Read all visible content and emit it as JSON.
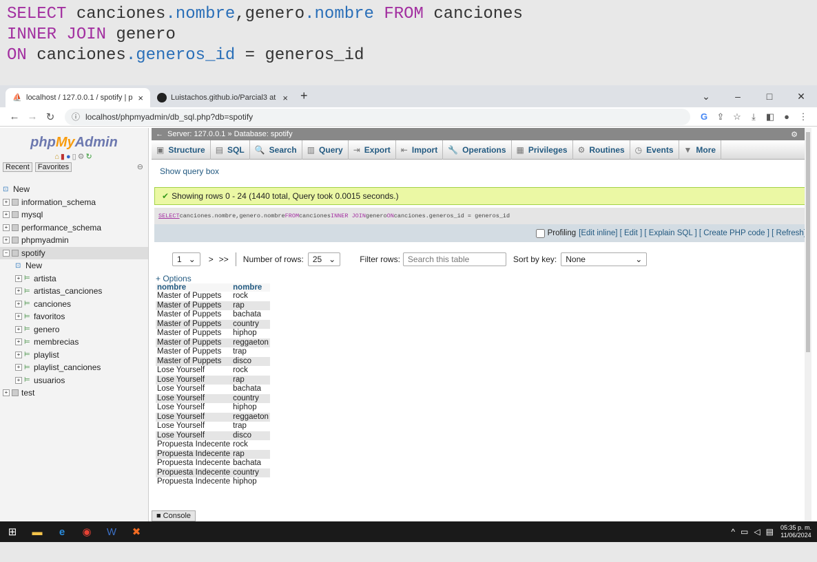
{
  "code_snippet": {
    "line1": {
      "kw1": "SELECT",
      "t1": " canciones",
      "d1": ".nombre",
      "t2": ",genero",
      "d2": ".nombre",
      "kw2": " FROM",
      "t3": " canciones"
    },
    "line2": {
      "kw": "INNER JOIN",
      "t": " genero"
    },
    "line3": {
      "kw": "ON",
      "t1": " canciones",
      "d": ".generos_id",
      "t2": " = generos_id"
    }
  },
  "browser": {
    "tabs": [
      {
        "title": "localhost / 127.0.0.1 / spotify | p",
        "close": "×"
      },
      {
        "title": "Luistachos.github.io/Parcial3 at",
        "close": "×"
      }
    ],
    "new_tab": "+",
    "url": "localhost/phpmyadmin/db_sql.php?db=spotify",
    "window_controls": [
      "⌄",
      "–",
      "□",
      "✕"
    ]
  },
  "sidebar": {
    "logo_php": "php",
    "logo_my": "My",
    "logo_admin": "Admin",
    "recent": "Recent",
    "favorites": "Favorites",
    "tree": [
      {
        "label": "New",
        "level": 0,
        "type": "new"
      },
      {
        "label": "information_schema",
        "level": 0,
        "type": "db"
      },
      {
        "label": "mysql",
        "level": 0,
        "type": "db"
      },
      {
        "label": "performance_schema",
        "level": 0,
        "type": "db"
      },
      {
        "label": "phpmyadmin",
        "level": 0,
        "type": "db"
      },
      {
        "label": "spotify",
        "level": 0,
        "type": "db",
        "selected": true
      },
      {
        "label": "New",
        "level": 1,
        "type": "new"
      },
      {
        "label": "artista",
        "level": 1,
        "type": "table"
      },
      {
        "label": "artistas_canciones",
        "level": 1,
        "type": "table"
      },
      {
        "label": "canciones",
        "level": 1,
        "type": "table"
      },
      {
        "label": "favoritos",
        "level": 1,
        "type": "table"
      },
      {
        "label": "genero",
        "level": 1,
        "type": "table"
      },
      {
        "label": "membrecias",
        "level": 1,
        "type": "table"
      },
      {
        "label": "playlist",
        "level": 1,
        "type": "table"
      },
      {
        "label": "playlist_canciones",
        "level": 1,
        "type": "table"
      },
      {
        "label": "usuarios",
        "level": 1,
        "type": "table"
      },
      {
        "label": "test",
        "level": 0,
        "type": "db"
      }
    ]
  },
  "main": {
    "breadcrumb": "Server: 127.0.0.1 » Database: spotify",
    "tabs": [
      "Structure",
      "SQL",
      "Search",
      "Query",
      "Export",
      "Import",
      "Operations",
      "Privileges",
      "Routines",
      "Events",
      "More"
    ],
    "show_query_box": "Show query box",
    "success_msg": "Showing rows 0 - 24 (1440 total, Query took 0.0015 seconds.)",
    "sql_text": {
      "k1": "SELECT",
      "a": " canciones.nombre,genero.nombre ",
      "k2": "FROM",
      "b": " canciones ",
      "k3": "INNER JOIN",
      "c": " genero ",
      "k4": "ON",
      "d": " canciones.generos_id = generos_id"
    },
    "profiling": "Profiling",
    "links": "[Edit inline] [ Edit ] [ Explain SQL ] [ Create PHP code ] [ Refresh]",
    "page_value": "1",
    "next": ">",
    "last": ">>",
    "rows_label": "Number of rows:",
    "rows_value": "25",
    "filter_label": "Filter rows:",
    "filter_placeholder": "Search this table",
    "sort_label": "Sort by key:",
    "sort_value": "None",
    "options": "+ Options",
    "columns": [
      "nombre",
      "nombre"
    ],
    "rows": [
      [
        "Master of Puppets",
        "rock"
      ],
      [
        "Master of Puppets",
        "rap"
      ],
      [
        "Master of Puppets",
        "bachata"
      ],
      [
        "Master of Puppets",
        "country"
      ],
      [
        "Master of Puppets",
        "hiphop"
      ],
      [
        "Master of Puppets",
        "reggaeton"
      ],
      [
        "Master of Puppets",
        "trap"
      ],
      [
        "Master of Puppets",
        "disco"
      ],
      [
        "Lose Yourself",
        "rock"
      ],
      [
        "Lose Yourself",
        "rap"
      ],
      [
        "Lose Yourself",
        "bachata"
      ],
      [
        "Lose Yourself",
        "country"
      ],
      [
        "Lose Yourself",
        "hiphop"
      ],
      [
        "Lose Yourself",
        "reggaeton"
      ],
      [
        "Lose Yourself",
        "trap"
      ],
      [
        "Lose Yourself",
        "disco"
      ],
      [
        "Propuesta Indecente",
        "rock"
      ],
      [
        "Propuesta Indecente",
        "rap"
      ],
      [
        "Propuesta Indecente",
        "bachata"
      ],
      [
        "Propuesta Indecente",
        "country"
      ],
      [
        "Propuesta Indecente",
        "hiphop"
      ]
    ],
    "console": "Console"
  },
  "taskbar": {
    "time": "05:35 p. m.",
    "date": "11/06/2024"
  }
}
